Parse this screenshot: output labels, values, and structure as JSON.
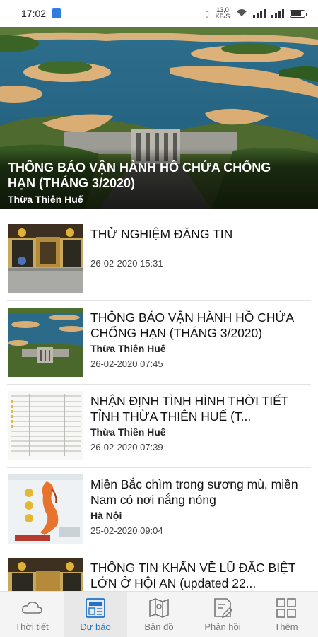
{
  "status": {
    "time": "17:02",
    "speed": "13,0 KB/S"
  },
  "hero": {
    "title": "THÔNG BÁO VẬN HÀNH HỒ CHỨA CHỐNG HẠN (THÁNG 3/2020)",
    "region": "Thừa Thiên Huế"
  },
  "items": [
    {
      "title": "THỬ NGHIỆM ĐĂNG TIN",
      "region": "",
      "date": "26-02-2020 15:31",
      "thumb": "flood-town-photo"
    },
    {
      "title": "THÔNG BÁO VẬN HÀNH HỒ CHỨA CHỐNG HẠN (THÁNG 3/2020)",
      "region": "Thừa Thiên Huế",
      "date": "26-02-2020 07:45",
      "thumb": "reservoir-dam-photo"
    },
    {
      "title": "NHẬN ĐỊNH TÌNH HÌNH THỜI TIẾT TỈNH THỪA THIÊN HUẾ (T...",
      "region": "Thừa Thiên Huế",
      "date": "26-02-2020 07:39",
      "thumb": "weather-table-doc"
    },
    {
      "title": "Miền Bắc chìm trong sương mù, miền Nam có nơi nắng nóng",
      "region": "Hà Nội",
      "date": "25-02-2020 09:04",
      "thumb": "vietnam-weather-map"
    },
    {
      "title": "THÔNG TIN KHẨN VỀ LŨ ĐẶC BIỆT LỚN Ở HỘI AN (updated 22...",
      "region": "",
      "date": "",
      "thumb": "flood-town-photo"
    }
  ],
  "nav": [
    {
      "label": "Thời tiết",
      "icon": "cloud-icon",
      "active": false
    },
    {
      "label": "Dự báo",
      "icon": "forecast-newspaper-icon",
      "active": true
    },
    {
      "label": "Bản đồ",
      "icon": "map-icon",
      "active": false
    },
    {
      "label": "Phản hồi",
      "icon": "feedback-icon",
      "active": false
    },
    {
      "label": "Thêm",
      "icon": "grid-icon",
      "active": false
    }
  ],
  "colors": {
    "accent": "#1f73c9",
    "nav_bg": "#f4f4f4"
  }
}
